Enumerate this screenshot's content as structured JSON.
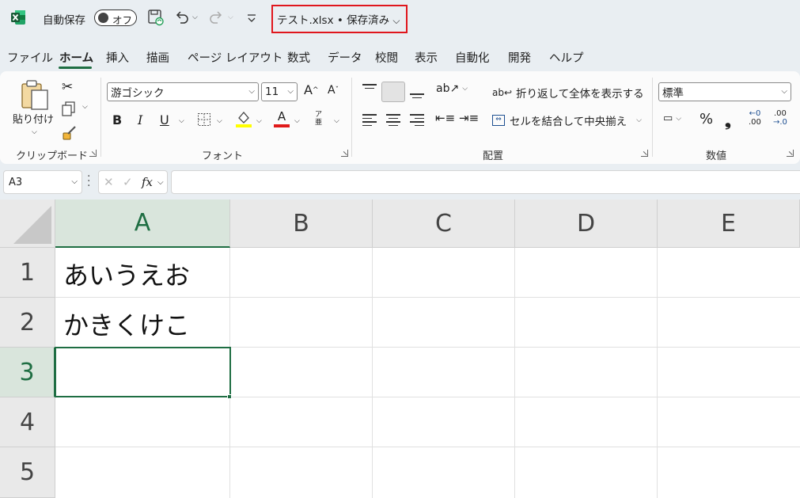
{
  "titlebar": {
    "autosave_label": "自動保存",
    "autosave_state": "オフ",
    "filename": "テスト.xlsx • 保存済み"
  },
  "tabs": [
    "ファイル",
    "ホーム",
    "挿入",
    "描画",
    "ページ レイアウト",
    "数式",
    "データ",
    "校閲",
    "表示",
    "自動化",
    "開発",
    "ヘルプ"
  ],
  "active_tab": "ホーム",
  "ribbon": {
    "clipboard": {
      "paste_label": "貼り付け",
      "group_label": "クリップボード"
    },
    "font": {
      "font_name": "游ゴシック",
      "font_size": "11",
      "grow": "A",
      "shrink": "A",
      "bold": "B",
      "italic": "I",
      "underline": "U",
      "font_color": "A",
      "phonetic_a": "亜",
      "phonetic_b": "ア",
      "group_label": "フォント"
    },
    "alignment": {
      "wrap_text": "折り返して全体を表示する",
      "merge_center": "セルを結合して中央揃え",
      "group_label": "配置"
    },
    "number": {
      "format": "標準",
      "percent": "%",
      "comma": "❟",
      "inc_decimal_a": "←0",
      "inc_decimal_b": ".00",
      "dec_decimal_a": ".00",
      "dec_decimal_b": "→.0",
      "group_label": "数値"
    }
  },
  "formula_bar": {
    "name_box": "A3",
    "fx": "fx",
    "formula": ""
  },
  "sheet": {
    "columns": [
      "A",
      "B",
      "C",
      "D",
      "E"
    ],
    "rows": [
      "1",
      "2",
      "3",
      "4",
      "5"
    ],
    "cells": {
      "A1": "あいうえお",
      "A2": "かきくけこ"
    },
    "selected_cell": "A3"
  },
  "colors": {
    "accent": "#1f6e43",
    "highlight_box": "#e0161d",
    "fill_yellow": "#ffff00",
    "font_red": "#e01a1a"
  }
}
